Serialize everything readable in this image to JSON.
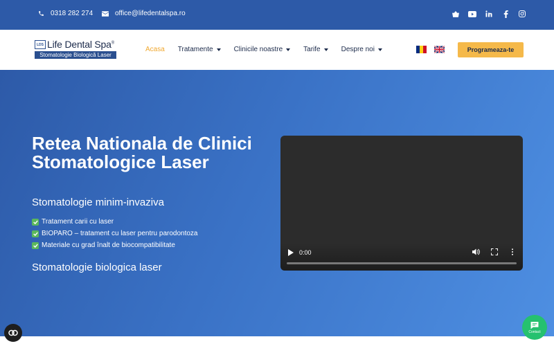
{
  "topbar": {
    "phone": "0318 282 274",
    "email": "office@lifedentalspa.ro",
    "socials": [
      "basket-icon",
      "youtube-icon",
      "linkedin-icon",
      "facebook-icon",
      "instagram-icon"
    ]
  },
  "logo": {
    "mark": "LDS",
    "brand": "Life Dental Spa",
    "registered": "®",
    "tagline": "Stomatologie Biologică Laser"
  },
  "nav": {
    "items": [
      {
        "label": "Acasa",
        "active": true,
        "dropdown": false
      },
      {
        "label": "Tratamente",
        "active": false,
        "dropdown": true
      },
      {
        "label": "Clinicile noastre",
        "active": false,
        "dropdown": true
      },
      {
        "label": "Tarife",
        "active": false,
        "dropdown": true
      },
      {
        "label": "Despre noi",
        "active": false,
        "dropdown": true
      }
    ],
    "cta": "Programeaza-te"
  },
  "hero": {
    "title": "Retea Nationala de Clinici Stomatologice Laser",
    "subtitle": "Stomatologie minim-invaziva",
    "features": [
      "Tratament carii cu laser",
      "BIOPARO – tratament cu laser pentru parodontoza",
      "Materiale cu grad înalt de biocompatibilitate"
    ],
    "footer_text": "Stomatologie biologica laser"
  },
  "video": {
    "time": "0:00",
    "progress": 0
  },
  "chat": {
    "label": "Contact"
  },
  "colors": {
    "topbar": "#2d5aa8",
    "accent": "#f5b94a",
    "active_nav": "#f0a830",
    "chat": "#25c16f"
  }
}
